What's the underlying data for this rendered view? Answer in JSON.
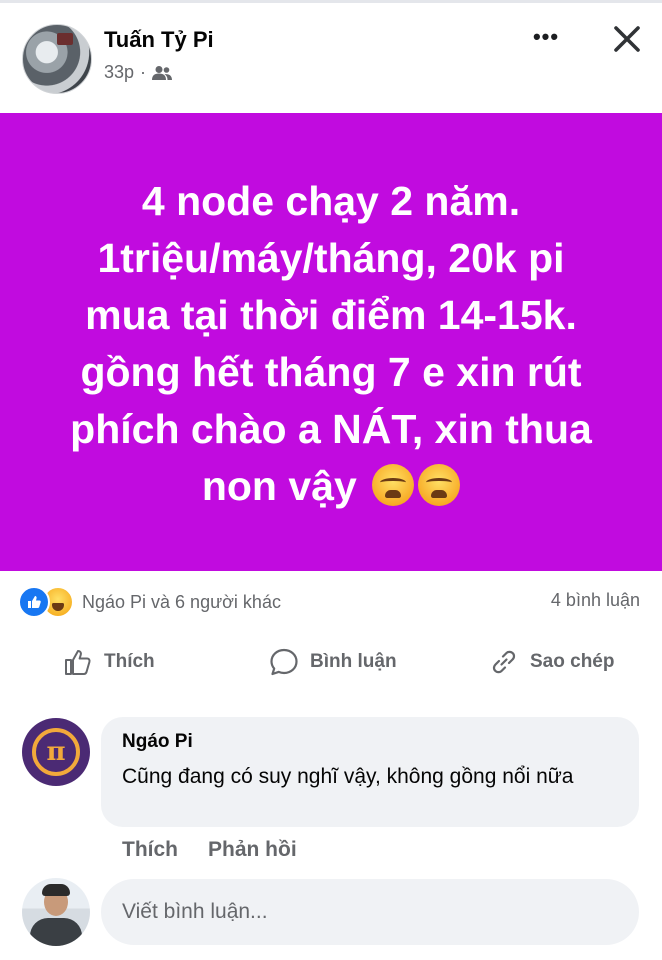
{
  "header": {
    "author": "Tuấn Tỷ Pi",
    "time": "33p",
    "separator": "·",
    "audience_icon": "friends-icon",
    "more_icon": "more-horizontal-icon",
    "close_icon": "close-icon"
  },
  "post": {
    "background_color": "#c10bdf",
    "line1": "4 node chạy 2 năm.",
    "line2": "1triệu/máy/tháng, 20k pi",
    "line3": "mua tại thời điểm 14-15k.",
    "line4": "gồng hết tháng 7 e xin rút",
    "line5": "phích chào a NÁT, xin thua",
    "line6": "non vậy"
  },
  "reactions": {
    "icons": [
      "like-reaction-icon",
      "haha-reaction-icon"
    ],
    "summary": "Ngáo Pi và 6 người khác",
    "comments": "4 bình luận"
  },
  "actions": {
    "like": "Thích",
    "comment": "Bình luận",
    "copy": "Sao chép"
  },
  "comment": {
    "author": "Ngáo Pi",
    "text": "Cũng đang có suy nghĩ vậy, không gồng nổi nữa",
    "like": "Thích",
    "reply": "Phản hồi"
  },
  "composer": {
    "placeholder": "Viết bình luận..."
  }
}
